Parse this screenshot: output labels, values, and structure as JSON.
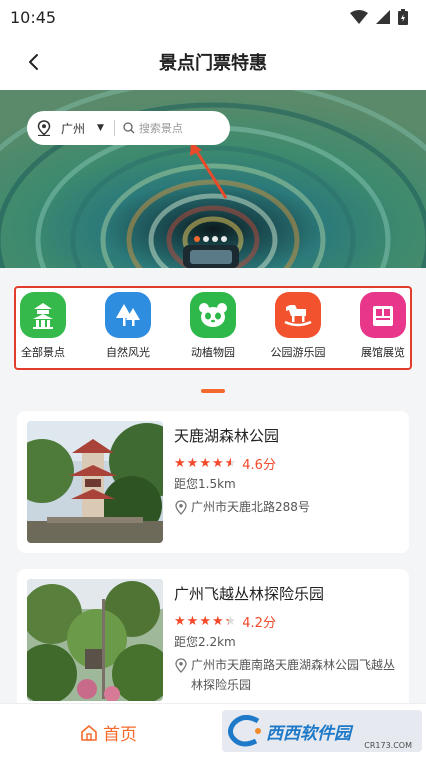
{
  "status_bar": {
    "time": "10:45"
  },
  "nav": {
    "title": "景点门票特惠"
  },
  "search": {
    "city": "广州",
    "placeholder": "搜索景点"
  },
  "banner": {
    "page_count": 4,
    "active_page": 0
  },
  "categories": [
    {
      "label": "全部景点",
      "color": "#35b94a",
      "icon": "pavilion-icon"
    },
    {
      "label": "自然风光",
      "color": "#2f8de0",
      "icon": "trees-icon"
    },
    {
      "label": "动植物园",
      "color": "#2fb84a",
      "icon": "panda-icon"
    },
    {
      "label": "公园游乐园",
      "color": "#f2532e",
      "icon": "rocking-horse-icon"
    },
    {
      "label": "展馆展览",
      "color": "#e8368a",
      "icon": "museum-icon"
    }
  ],
  "spots": [
    {
      "title": "天鹿湖森林公园",
      "rating": "4.6分",
      "distance": "距您1.5km",
      "address": "广州市天鹿北路288号"
    },
    {
      "title": "广州飞越丛林探险乐园",
      "rating": "4.2分",
      "distance": "距您2.2km",
      "address": "广州市天鹿南路天鹿湖森林公园飞越丛林探险乐园"
    }
  ],
  "bottom_nav": {
    "home_label": "首页"
  },
  "watermark": {
    "brand": "西西软件园",
    "site": "CR173.COM"
  },
  "colors": {
    "accent": "#f56a2c",
    "star": "#f2492a",
    "highlight_border": "#e23d2c"
  }
}
